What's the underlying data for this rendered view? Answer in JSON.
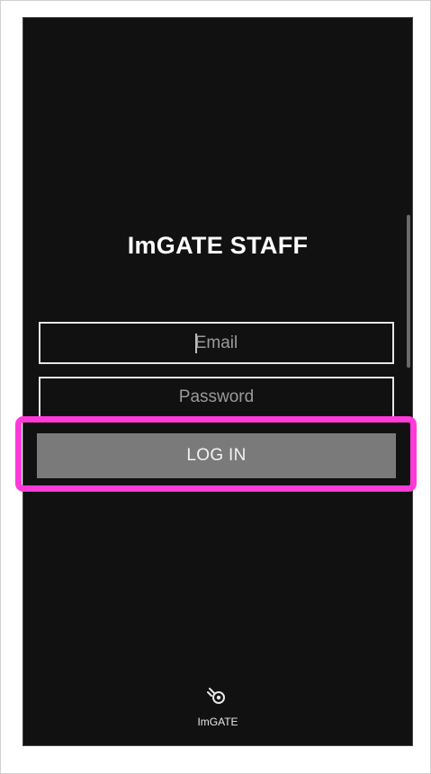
{
  "app": {
    "title": "ImGATE STAFF"
  },
  "login_form": {
    "email_placeholder": "Email",
    "password_placeholder": "Password",
    "login_label": "LOG IN"
  },
  "footer": {
    "logo_icon": "imgate-logo-icon",
    "brand_text": "ImGATE"
  },
  "annotation": {
    "highlight_color": "#ff3ad8",
    "highlighted_element": "login-button"
  },
  "colors": {
    "background": "#111111",
    "button": "#7a7a7a",
    "text": "#ffffff"
  }
}
